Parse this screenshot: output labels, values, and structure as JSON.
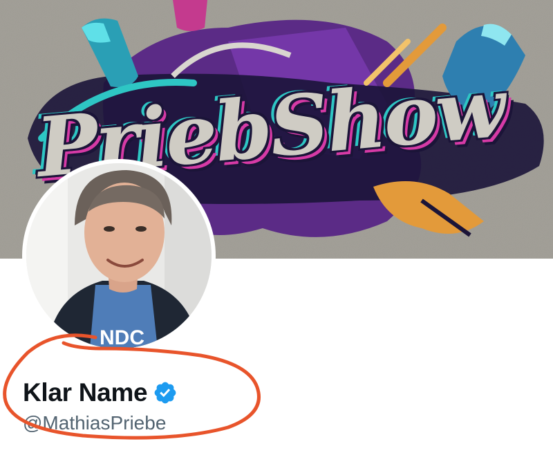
{
  "banner": {
    "title": "PriebShow",
    "palette": {
      "wall": "#a8a59d",
      "purple": "#5b2b86",
      "magenta": "#d63aa6",
      "teal": "#2ec6c4",
      "navy": "#1b1438",
      "orange": "#e39a3a"
    }
  },
  "profile": {
    "display_name": "Klar Name",
    "handle": "@MathiasPriebe",
    "verified_icon": "verified-badge-icon",
    "verified_color": "#1d9bf0",
    "avatar_shirt_text": "NDC"
  },
  "annotation": {
    "color": "#e8542b"
  }
}
